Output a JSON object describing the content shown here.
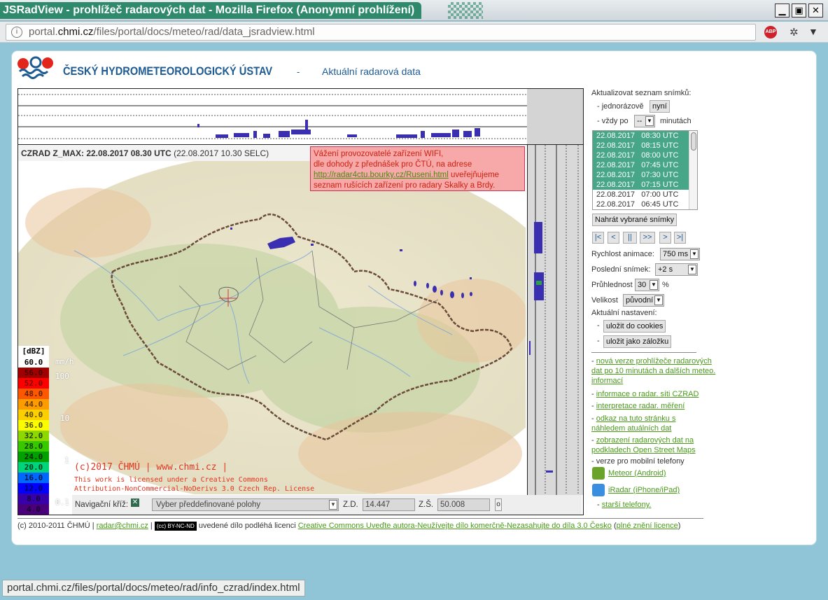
{
  "window": {
    "title": "JSRadView - prohlížeč radarových dat - Mozilla Firefox (Anonymní prohlížení)",
    "controls": {
      "minimize": "▁",
      "maximize": "▣",
      "close": "✕"
    }
  },
  "urlbar": {
    "url_prefix": "portal.",
    "url_host": "chmi.cz",
    "url_path": "/files/portal/docs/meteo/rad/data_jsradview.html",
    "adblock_label": "ABP",
    "icons": [
      "info-icon",
      "adblock-icon",
      "bug-icon",
      "menu-icon"
    ]
  },
  "header": {
    "org_name": "ČESKÝ HYDROMETEOROLOGICKÝ ÚSTAV",
    "separator": "-",
    "page_title": "Aktuální radarová data"
  },
  "map": {
    "product_bold": "CZRAD Z_MAX: 22.08.2017 08.30 UTC",
    "product_local": " (22.08.2017 10.30 SELC)",
    "wifi_notice": {
      "line1": "Vážení provozovatelé zařízení WIFI,",
      "line2": "dle dohody z přednášek pro ČTÚ, na adrese",
      "link": "http://radar4ctu.bourky.cz/Ruseni.html",
      "line3_after_link": " uveřejňujeme",
      "line4": "seznam rušících zařízení pro radary Skalky a Brdy."
    },
    "copyright_line": "(c)2017 ČHMÚ | www.chmi.cz |",
    "license_line1": "This work is licensed under a Creative Commons",
    "license_line2": "Attribution-NonCommercial-NoDerivs 3.0 Czech Rep. License"
  },
  "legend": {
    "title": "[dBZ]",
    "unit": "mm/h",
    "rows": [
      {
        "value": "60.0",
        "color": "#ffffff",
        "text_color": "#000000"
      },
      {
        "value": "56.0",
        "color": "#a00000",
        "text_color": "#4a0000"
      },
      {
        "value": "52.0",
        "color": "#fc0000",
        "text_color": "#7a0000"
      },
      {
        "value": "48.0",
        "color": "#fc5800",
        "text_color": "#6a2000"
      },
      {
        "value": "44.0",
        "color": "#fc9c00",
        "text_color": "#6a3a00"
      },
      {
        "value": "40.0",
        "color": "#fcd000",
        "text_color": "#5a4a00"
      },
      {
        "value": "36.0",
        "color": "#fcfc00",
        "text_color": "#4a4a00"
      },
      {
        "value": "32.0",
        "color": "#8cd800",
        "text_color": "#224000"
      },
      {
        "value": "28.0",
        "color": "#38c800",
        "text_color": "#0a3a00"
      },
      {
        "value": "24.0",
        "color": "#00a000",
        "text_color": "#002a00"
      },
      {
        "value": "20.0",
        "color": "#00d47a",
        "text_color": "#003a20"
      },
      {
        "value": "16.0",
        "color": "#0068fc",
        "text_color": "#001a50"
      },
      {
        "value": "12.0",
        "color": "#0000fc",
        "text_color": "#00005a"
      },
      {
        "value": "8.0",
        "color": "#3800a8",
        "text_color": "#12003a"
      },
      {
        "value": "4.0",
        "color": "#4a007a",
        "text_color": "#1a002a"
      }
    ],
    "mmh_labels": [
      "100",
      "10",
      "1",
      "0.1"
    ]
  },
  "navigation": {
    "cross_label": "Navigační kříž:",
    "checkbox_mark": "✕",
    "position_select": "Vyber předdefinované polohy",
    "lon_label": "Z.D.",
    "lon_value": "14.447",
    "lat_label": "Z.Š.",
    "lat_value": "50.008",
    "go_label": "o"
  },
  "panel": {
    "update_list_label": "Aktualizovat seznam snímků:",
    "once_label": "- jednorázově",
    "now_button": "nyní",
    "every_label": "- vždy po",
    "every_value": "--",
    "minutes_label": "minutách",
    "snapshots": [
      {
        "date": "22.08.2017",
        "time": "08:30 UTC",
        "selected": true
      },
      {
        "date": "22.08.2017",
        "time": "08:15 UTC",
        "selected": true
      },
      {
        "date": "22.08.2017",
        "time": "08:00 UTC",
        "selected": true
      },
      {
        "date": "22.08.2017",
        "time": "07:45 UTC",
        "selected": true
      },
      {
        "date": "22.08.2017",
        "time": "07:30 UTC",
        "selected": true
      },
      {
        "date": "22.08.2017",
        "time": "07:15 UTC",
        "selected": true
      },
      {
        "date": "22.08.2017",
        "time": "07:00 UTC",
        "selected": false
      },
      {
        "date": "22.08.2017",
        "time": "06:45 UTC",
        "selected": false
      }
    ],
    "load_button": "Nahrát vybrané snímky",
    "playback": [
      "|<",
      "<",
      "||",
      ">>",
      ">",
      ">|"
    ],
    "speed_label": "Rychlost animace:",
    "speed_value": "750 ms",
    "last_label": "Poslední snímek:",
    "last_value": "+2 s",
    "opacity_label": "Průhlednost",
    "opacity_value": "30",
    "opacity_unit": "%",
    "size_label": "Velikost",
    "size_value": "původní",
    "current_label": "Aktuální nastavení:",
    "save_cookies": "uložit do cookies",
    "save_bookmark": "uložit jako záložku",
    "links": [
      "nová verze prohlížeče radarových dat po 10 minutách a dalších meteo. informací",
      "informace o radar. síti CZRAD",
      "interpretace radar. měření",
      "odkaz na tuto stránku s náhledem atuálních dat",
      "zobrazení radarových dat na podkladech Open Street Maps"
    ],
    "mobile_label": "verze pro mobilní telefony",
    "meteor_link": "Meteor (Android)",
    "iradar_link": "iRadar (iPhone/iPad)",
    "older_phones": "starší telefony."
  },
  "footer": {
    "copyright": "(c) 2010-2011 ČHMÚ |",
    "email": "radar@chmi.cz",
    "cc_badge": "(cc) BY-NC-ND",
    "license_text": "uvedené dílo podléhá licenci",
    "license_link": "Creative Commons Uveďte autora-Neužívejte dílo komerčně-Nezasahujte do díla 3.0 Česko",
    "full_license_open": "(",
    "full_license_link": "plné znění licence",
    "full_license_close": ")"
  },
  "statusbar": {
    "text": "portal.chmi.cz/files/portal/docs/meteo/rad/info_czrad/index.html"
  }
}
